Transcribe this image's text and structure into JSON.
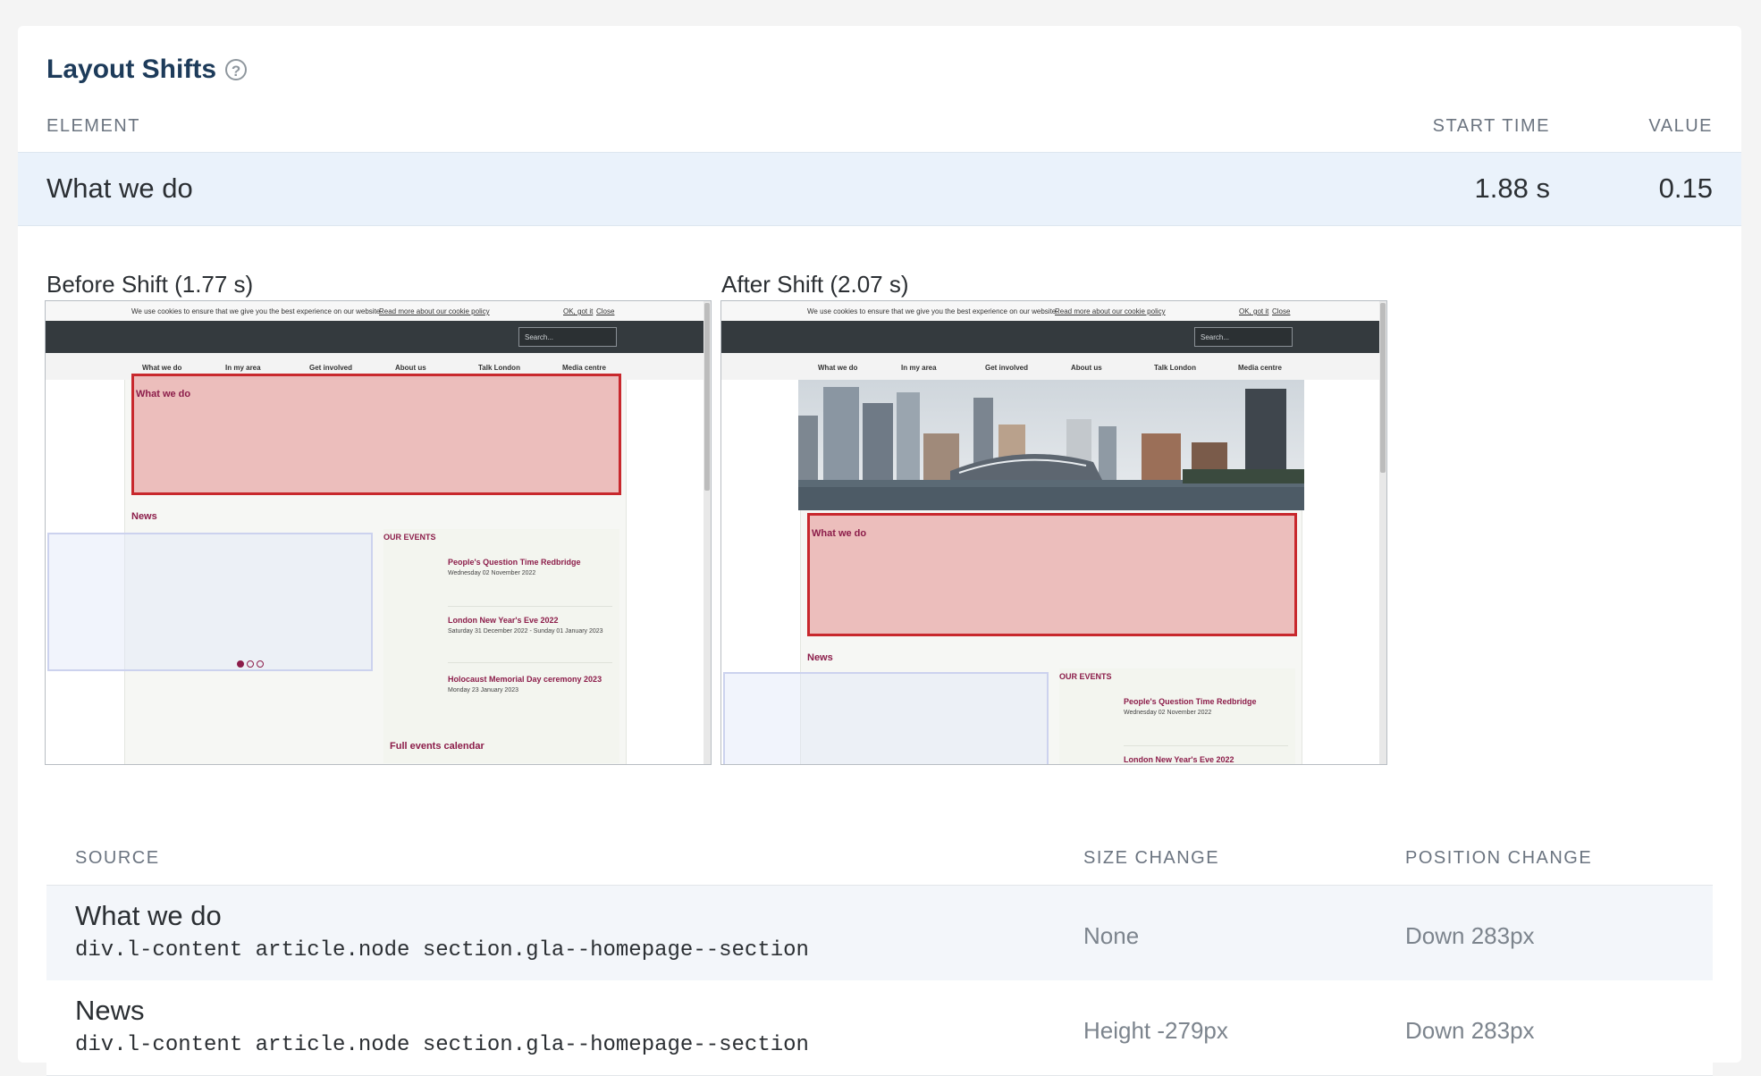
{
  "section": {
    "title": "Layout Shifts",
    "help_icon": "?"
  },
  "table": {
    "headers": {
      "element": "ELEMENT",
      "start_time": "START TIME",
      "value": "VALUE"
    },
    "row": {
      "element": "What we do",
      "start_time": "1.88 s",
      "value": "0.15"
    }
  },
  "before": {
    "label": "Before Shift (1.77 s)"
  },
  "after": {
    "label": "After Shift (2.07 s)"
  },
  "thumb": {
    "cookie_text": "We use cookies to ensure that we give you the best experience on our website.",
    "cookie_link": "Read more about our cookie policy",
    "ok": "OK, got it",
    "close": "Close",
    "search_placeholder": "Search...",
    "nav": [
      "What we do",
      "In my area",
      "Get involved",
      "About us",
      "Talk London",
      "Media centre"
    ],
    "highlight_label": "What we do",
    "news": "News",
    "events_heading": "OUR EVENTS",
    "events": [
      {
        "title": "People's Question Time Redbridge",
        "date": "Wednesday 02 November 2022"
      },
      {
        "title": "London New Year's Eve 2022",
        "date": "Saturday 31 December 2022 - Sunday 01 January 2023"
      },
      {
        "title": "Holocaust Memorial Day ceremony 2023",
        "date": "Monday 23 January 2023"
      }
    ],
    "full_calendar": "Full events calendar"
  },
  "sources": {
    "headers": {
      "source": "SOURCE",
      "size_change": "SIZE CHANGE",
      "position_change": "POSITION CHANGE"
    },
    "rows": [
      {
        "name": "What we do",
        "selector": "div.l-content article.node section.gla--homepage--section",
        "size_change": "None",
        "position_change": "Down 283px"
      },
      {
        "name": "News",
        "selector": "div.l-content article.node section.gla--homepage--section",
        "size_change": "Height -279px",
        "position_change": "Down 283px"
      }
    ]
  },
  "colors": {
    "title": "#1d3b5a",
    "row_highlight": "#eaf2fb",
    "shift_box": "#c8282d",
    "brand": "#8c1d4a"
  }
}
